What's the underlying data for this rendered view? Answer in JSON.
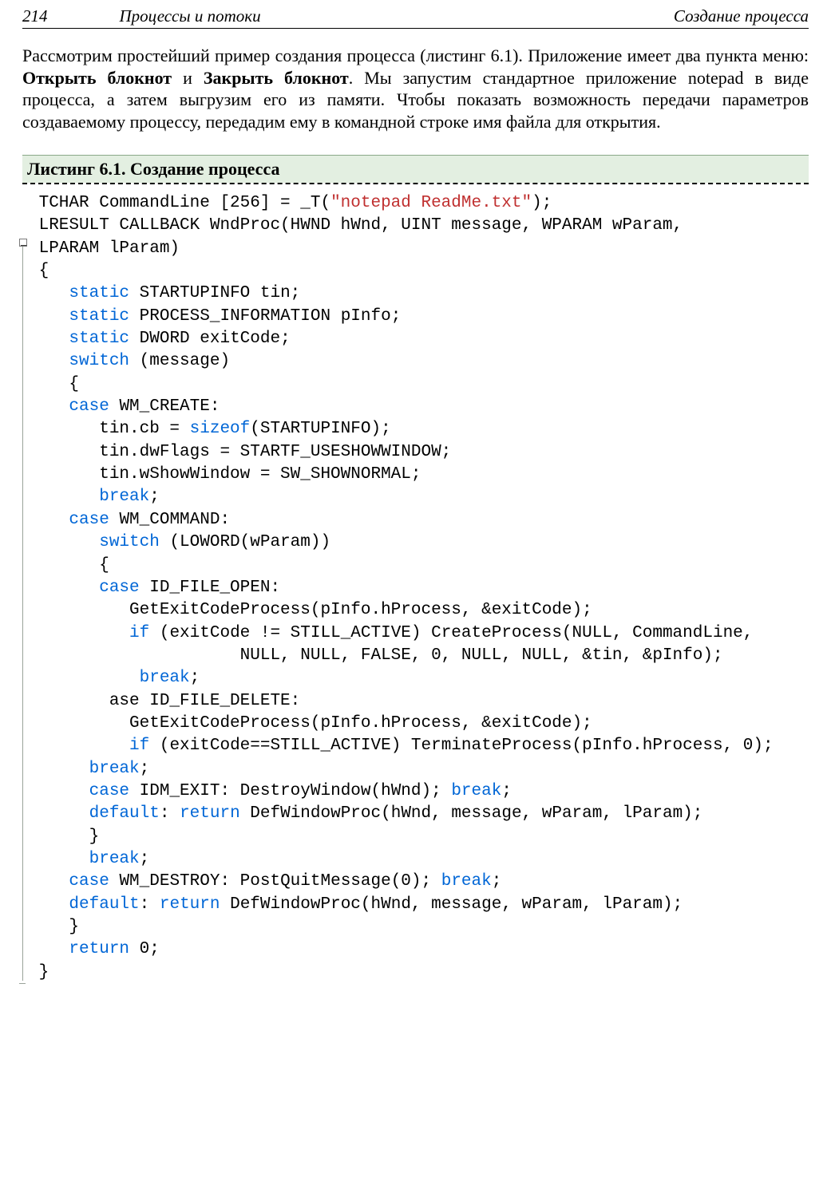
{
  "header": {
    "page_number": "214",
    "chapter": "Процессы и потоки",
    "section": "Создание процесса"
  },
  "paragraph": {
    "t1": "Рассмотрим простейший пример создания процесса (листинг 6.1). Приложение имеет два пункта меню: ",
    "b1": "Открыть блокнот",
    "t2": " и ",
    "b2": "Закрыть блокнот",
    "t3": ". Мы запустим стандартное приложение notepad в виде процесса, а затем выгрузим его из памяти. Чтобы показать возможность передачи параметров создаваемому процессу, передадим ему в командной строке имя файла для открытия."
  },
  "listing": {
    "caption": "Листинг 6.1. Создание процесса",
    "code": {
      "l01a": " TCHAR CommandLine [256] = _T(",
      "l01b": "\"notepad ReadMe.txt\"",
      "l01c": ");",
      "l02": " LRESULT CALLBACK WndProc(HWND hWnd, UINT message, WPARAM wParam,",
      "l03": " LPARAM lParam)",
      "l04": " {",
      "l05a": "    ",
      "l05b": "static",
      "l05c": " STARTUPINFO tin;",
      "l06a": "    ",
      "l06b": "static",
      "l06c": " PROCESS_INFORMATION pInfo;",
      "l07a": "    ",
      "l07b": "static",
      "l07c": " DWORD exitCode;",
      "l08a": "    ",
      "l08b": "switch",
      "l08c": " (message)",
      "l09": "    {",
      "l10a": "    ",
      "l10b": "case",
      "l10c": " WM_CREATE:",
      "l11a": "       tin.cb = ",
      "l11b": "sizeof",
      "l11c": "(STARTUPINFO);",
      "l12": "       tin.dwFlags = STARTF_USESHOWWINDOW;",
      "l13": "       tin.wShowWindow = SW_SHOWNORMAL;",
      "l14a": "       ",
      "l14b": "break",
      "l14c": ";",
      "l15a": "    ",
      "l15b": "case",
      "l15c": " WM_COMMAND:",
      "l16a": "       ",
      "l16b": "switch",
      "l16c": " (LOWORD(wParam))",
      "l17": "       {",
      "l18a": "       ",
      "l18b": "case",
      "l18c": " ID_FILE_OPEN:",
      "l19": "          GetExitCodeProcess(pInfo.hProcess, &exitCode);",
      "l20a": "          ",
      "l20b": "if",
      "l20c": " (exitCode != STILL_ACTIVE) CreateProcess(NULL, CommandLine,",
      "l21": "                     NULL, NULL, FALSE, 0, NULL, NULL, &tin, &pInfo);",
      "l22a": "           ",
      "l22b": "break",
      "l22c": ";",
      "l23": "        ase ID_FILE_DELETE:",
      "l24": "          GetExitCodeProcess(pInfo.hProcess, &exitCode);",
      "l25a": "          ",
      "l25b": "if",
      "l25c": " (exitCode==STILL_ACTIVE) TerminateProcess(pInfo.hProcess, 0);",
      "l26a": "      ",
      "l26b": "break",
      "l26c": ";",
      "l27a": "      ",
      "l27b": "case",
      "l27c": " IDM_EXIT: DestroyWindow(hWnd); ",
      "l27d": "break",
      "l27e": ";",
      "l28a": "      ",
      "l28b": "default",
      "l28c": ": ",
      "l28d": "return",
      "l28e": " DefWindowProc(hWnd, message, wParam, lParam);",
      "l29": "      }",
      "l30a": "      ",
      "l30b": "break",
      "l30c": ";",
      "l31a": "    ",
      "l31b": "case",
      "l31c": " WM_DESTROY: PostQuitMessage(0); ",
      "l31d": "break",
      "l31e": ";",
      "l32a": "    ",
      "l32b": "default",
      "l32c": ": ",
      "l32d": "return",
      "l32e": " DefWindowProc(hWnd, message, wParam, lParam);",
      "l33": "    }",
      "l34a": "    ",
      "l34b": "return",
      "l34c": " 0;",
      "l35": " }"
    }
  }
}
